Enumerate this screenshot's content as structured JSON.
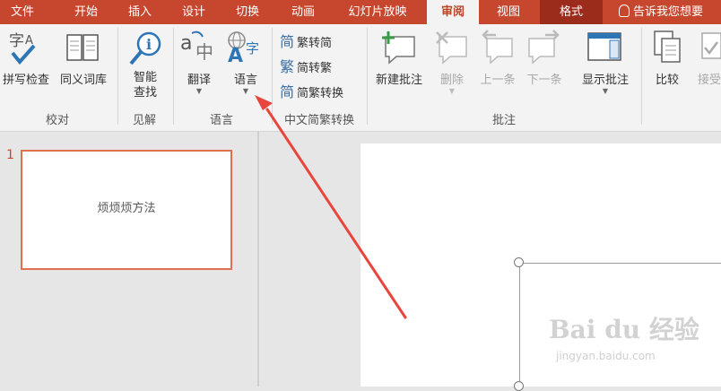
{
  "tabs": [
    {
      "label": "文件"
    },
    {
      "label": "开始"
    },
    {
      "label": "插入"
    },
    {
      "label": "设计"
    },
    {
      "label": "切换"
    },
    {
      "label": "动画"
    },
    {
      "label": "幻灯片放映"
    },
    {
      "label": "审阅"
    },
    {
      "label": "视图"
    },
    {
      "label": "格式"
    }
  ],
  "tellme": {
    "text": "告诉我您想要"
  },
  "ribbon": {
    "proofing": {
      "spell": "拼写检查",
      "thesaurus": "同义词库",
      "group": "校对"
    },
    "insights": {
      "smart_lookup_line1": "智能",
      "smart_lookup_line2": "查找",
      "group": "见解"
    },
    "language": {
      "translate": "翻译",
      "language": "语言",
      "group": "语言"
    },
    "chinese_conversion": {
      "to_simplified": "繁转简",
      "to_traditional": "简转繁",
      "convert": "简繁转换",
      "group": "中文简繁转换"
    },
    "comments": {
      "new": "新建批注",
      "delete": "删除",
      "prev": "上一条",
      "next": "下一条",
      "show": "显示批注",
      "group": "批注"
    },
    "compare": {
      "compare": "比较",
      "accept": "接受"
    }
  },
  "slides": [
    {
      "number": "1",
      "text": "烦烦烦方法"
    }
  ],
  "watermark": {
    "brand": "Bai du 经验",
    "url": "jingyan.baidu.com"
  },
  "colors": {
    "accent": "#c7472e",
    "arrow": "#e8453c"
  }
}
